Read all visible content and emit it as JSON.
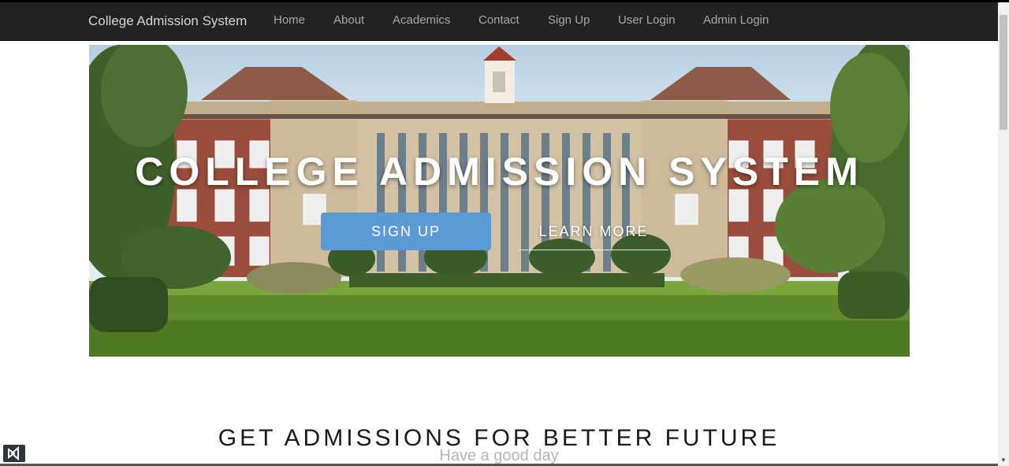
{
  "navbar": {
    "brand": "College Admission System",
    "items": [
      "Home",
      "About",
      "Academics",
      "Contact",
      "Sign Up",
      "User Login",
      "Admin Login"
    ]
  },
  "hero": {
    "image": "college-building-photo",
    "title": "COLLEGE ADMISSION SYSTEM",
    "signup_label": "SIGN UP",
    "learn_more_label": "LEARN MORE"
  },
  "section": {
    "heading": "GET ADMISSIONS FOR BETTER FUTURE",
    "subheading": "Have a good day"
  },
  "colors": {
    "navbar_bg": "#222222",
    "brand_text": "#d6d6d6",
    "nav_text": "#a8a8a8",
    "signup_button": "#5b9bd5"
  },
  "icons": {
    "corner": "visual-studio-icon",
    "scroll_down": "arrow-down-icon"
  }
}
